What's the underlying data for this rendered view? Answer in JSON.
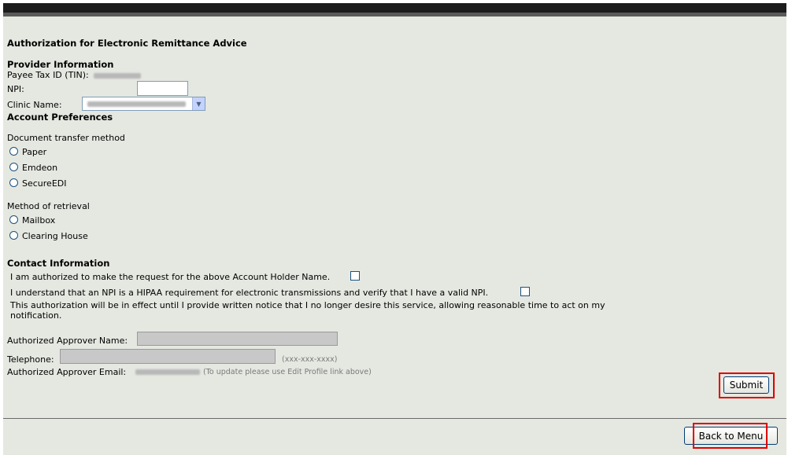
{
  "form": {
    "title": "Authorization for Electronic Remittance Advice",
    "provider_heading": "Provider Information",
    "tin_label": "Payee Tax ID (TIN):",
    "npi_label": "NPI:",
    "npi_value": "",
    "clinic_label": "Clinic Name:",
    "account_heading": "Account Preferences",
    "transfer_label": "Document transfer method",
    "transfer_options": [
      "Paper",
      "Emdeon",
      "SecureEDI"
    ],
    "retrieval_label": "Method of retrieval",
    "retrieval_options": [
      "Mailbox",
      "Clearing House"
    ],
    "contact_heading": "Contact Information",
    "authorized_statement": "I am authorized to make the request for the above Account Holder Name.",
    "npi_statement": "I understand that an NPI is a HIPAA requirement for electronic transmissions and verify that I have a valid NPI.",
    "notice_line1": "This authorization will be in effect until I provide written notice that I no longer desire this service, allowing reasonable time to act on my",
    "notice_line2": "notification.",
    "approver_name_label": "Authorized Approver Name:",
    "telephone_label": "Telephone:",
    "telephone_hint": "(xxx-xxx-xxxx)",
    "email_label": "Authorized Approver Email:",
    "email_hint": "(To update please use Edit Profile link above)"
  },
  "buttons": {
    "submit": "Submit",
    "back": "Back to Menu"
  },
  "colors": {
    "panel_bg": "#e5e8e1",
    "highlight": "#e00000",
    "button_border": "#003c74"
  }
}
